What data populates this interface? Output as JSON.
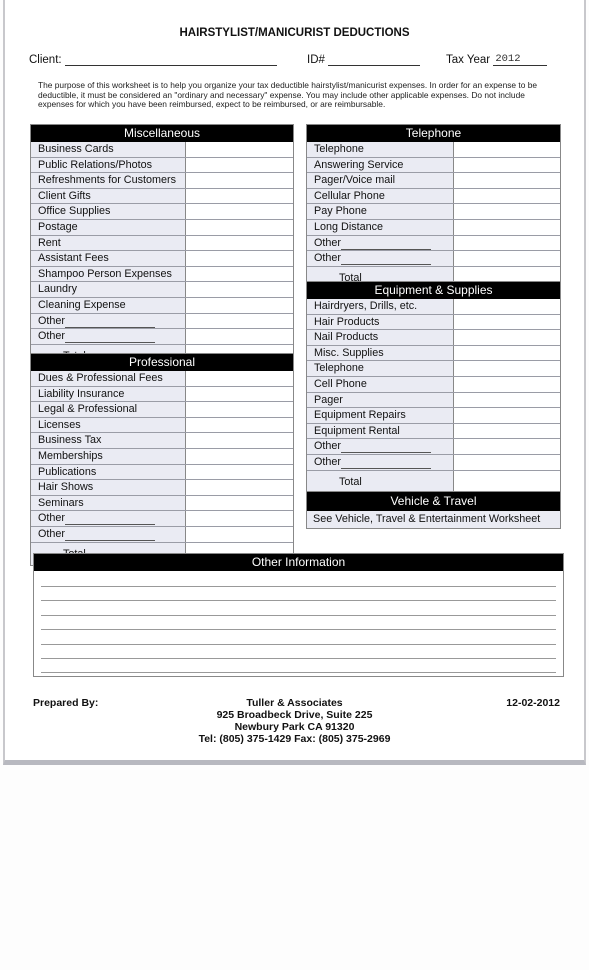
{
  "title": "HAIRSTYLIST/MANICURIST DEDUCTIONS",
  "header": {
    "client_label": "Client:",
    "client_value": "",
    "id_label": "ID#",
    "id_value": "",
    "tax_year_label": "Tax Year",
    "tax_year_value": "2012"
  },
  "intro": "The purpose of this worksheet is to help you organize your tax deductible hairstylist/manicurist expenses. In order for an expense to be deductible, it must be considered an \"ordinary and necessary\" expense. You may include other applicable expenses. Do not include expenses for which you have been reimbursed, expect to be reimbursed, or are reimbursable.",
  "sections": {
    "miscellaneous": {
      "title": "Miscellaneous",
      "items": [
        "Business Cards",
        "Public Relations/Photos",
        "Refreshments for Customers",
        "Client Gifts",
        "Office Supplies",
        "Postage",
        "Rent",
        "Assistant Fees",
        "Shampoo Person Expenses",
        "Laundry",
        "Cleaning Expense"
      ],
      "other_label": "Other",
      "total_label": "Total"
    },
    "professional": {
      "title": "Professional",
      "items": [
        "Dues & Professional Fees",
        "Liability Insurance",
        "Legal & Professional",
        "Licenses",
        "Business Tax",
        "Memberships",
        "Publications",
        "Hair Shows",
        "Seminars"
      ],
      "other_label": "Other",
      "total_label": "Total"
    },
    "telephone": {
      "title": "Telephone",
      "items": [
        "Telephone",
        "Answering Service",
        "Pager/Voice mail",
        "Cellular Phone",
        "Pay Phone",
        "Long Distance"
      ],
      "other_label": "Other",
      "total_label": "Total"
    },
    "equipment": {
      "title": "Equipment & Supplies",
      "items": [
        "Hairdryers, Drills, etc.",
        "Hair Products",
        "Nail Products",
        "Misc. Supplies",
        "Telephone",
        "Cell Phone",
        "Pager",
        "Equipment Repairs",
        "Equipment Rental"
      ],
      "other_label": "Other",
      "total_label": "Total"
    },
    "vehicle": {
      "title": "Vehicle & Travel",
      "note": "See Vehicle, Travel & Entertainment Worksheet"
    },
    "other_information": {
      "title": "Other Information"
    }
  },
  "footer": {
    "prepared_by": "Prepared By:",
    "company": "Tuller &  Associates",
    "address1": "925 Broadbeck Drive, Suite 225",
    "address2": "Newbury Park CA 91320",
    "phone": "Tel: (805) 375-1429   Fax: (805) 375-2969",
    "date": "12-02-2012"
  }
}
